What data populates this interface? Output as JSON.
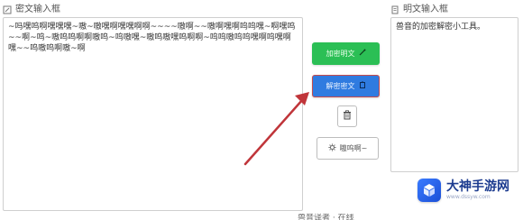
{
  "left_panel": {
    "label": "密文输入框",
    "icon": "edit-icon",
    "content": "~吗嘿呜啊嘿嘿嘿~嗷~嗷嘿啊嘿嘿啊啊~~~~嗷啊~~嗷啊嘿啊呜呜嘿~啊嘿呜~~啊~呜~嗷呜呜啊啊嗷呜~呜嗷嘿~嗷呜嗷嘿呜啊啊~呜呜嗷呜呜嘿啊呜嘿啊嘿~~呜嗷呜啊嗷~啊"
  },
  "right_panel": {
    "label": "明文输入框",
    "icon": "document-icon",
    "content": "兽音的加密解密小工具。"
  },
  "buttons": {
    "encrypt_label": "加密明文",
    "encrypt_icon": "magic-wand-icon",
    "decrypt_label": "解密密文",
    "decrypt_icon": "clipboard-icon",
    "clear_icon": "trash-icon",
    "settings_label": "嗷呜啊~",
    "settings_icon": "gear-icon"
  },
  "logo": {
    "title": "大神手游网",
    "subtitle": "www.dssyw.com"
  },
  "footer_text": "兽音译者 · 在线",
  "colors": {
    "green": "#2bbf55",
    "blue": "#2f7be0",
    "arrow": "#c0353a"
  }
}
